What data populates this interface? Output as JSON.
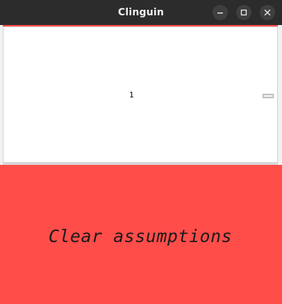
{
  "window": {
    "title": "Clinguin",
    "controls": {
      "minimize_icon": "minimize-icon",
      "maximize_icon": "maximize-icon",
      "close_icon": "close-icon"
    }
  },
  "panel": {
    "value": "1"
  },
  "clear_button": {
    "label": "Clear assumptions",
    "color": "#ff4d4a"
  }
}
